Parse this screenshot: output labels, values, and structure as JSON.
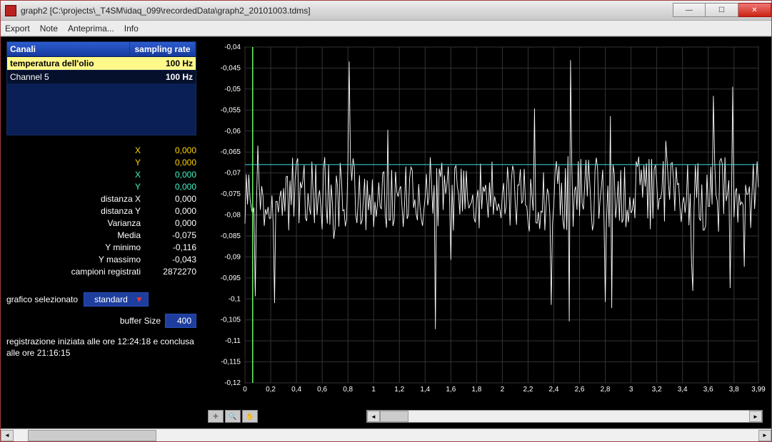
{
  "window": {
    "title": "graph2   [C:\\projects\\_T4SM\\idaq_099\\recordedData\\graph2_20101003.tdms]"
  },
  "menu": {
    "export": "Export",
    "note": "Note",
    "anteprima": "Anteprima...",
    "info": "Info"
  },
  "table": {
    "header_channels": "Canali",
    "header_rate": "sampling rate",
    "rows": [
      {
        "name": "temperatura dell'olio",
        "rate": "100 Hz"
      },
      {
        "name": "Channel 5",
        "rate": "100 Hz"
      }
    ]
  },
  "stats": {
    "x1_label": "X",
    "x1": "0,000",
    "y1_label": "Y",
    "y1": "0,000",
    "x2_label": "X",
    "x2": "0,000",
    "y2_label": "Y",
    "y2": "0,000",
    "dx_label": "distanza X",
    "dx": "0,000",
    "dy_label": "distanza Y",
    "dy": "0,000",
    "var_label": "Varianza",
    "var": "0,000",
    "media_label": "Media",
    "media": "-0,075",
    "ymin_label": "Y minimo",
    "ymin": "-0,116",
    "ymax_label": "Y massimo",
    "ymax": "-0,043",
    "samples_label": "campioni registrati",
    "samples": "2872270"
  },
  "selector": {
    "label": "grafico selezionato",
    "value": "standard"
  },
  "buffer": {
    "label": "buffer Size",
    "value": "400"
  },
  "note_text": "registrazione iniziata alle ore 12:24:18 e conclusa alle ore 21:16:15",
  "chart_data": {
    "type": "line",
    "xlabel": "",
    "ylabel": "",
    "xlim": [
      0,
      3.99
    ],
    "ylim": [
      -0.12,
      -0.04
    ],
    "xticks": [
      0,
      0.2,
      0.4,
      0.6,
      0.8,
      1,
      1.2,
      1.4,
      1.6,
      1.8,
      2,
      2.2,
      2.4,
      2.6,
      2.8,
      3,
      3.2,
      3.4,
      3.6,
      3.8,
      3.99
    ],
    "yticks": [
      -0.04,
      -0.045,
      -0.05,
      -0.055,
      -0.06,
      -0.065,
      -0.07,
      -0.075,
      -0.08,
      -0.085,
      -0.09,
      -0.095,
      -0.1,
      -0.105,
      -0.11,
      -0.115,
      -0.12
    ],
    "cursor_x": 0.06,
    "cursor_y": -0.068,
    "mean": -0.075,
    "ymin": -0.116,
    "ymax": -0.043,
    "n_points": 400
  }
}
